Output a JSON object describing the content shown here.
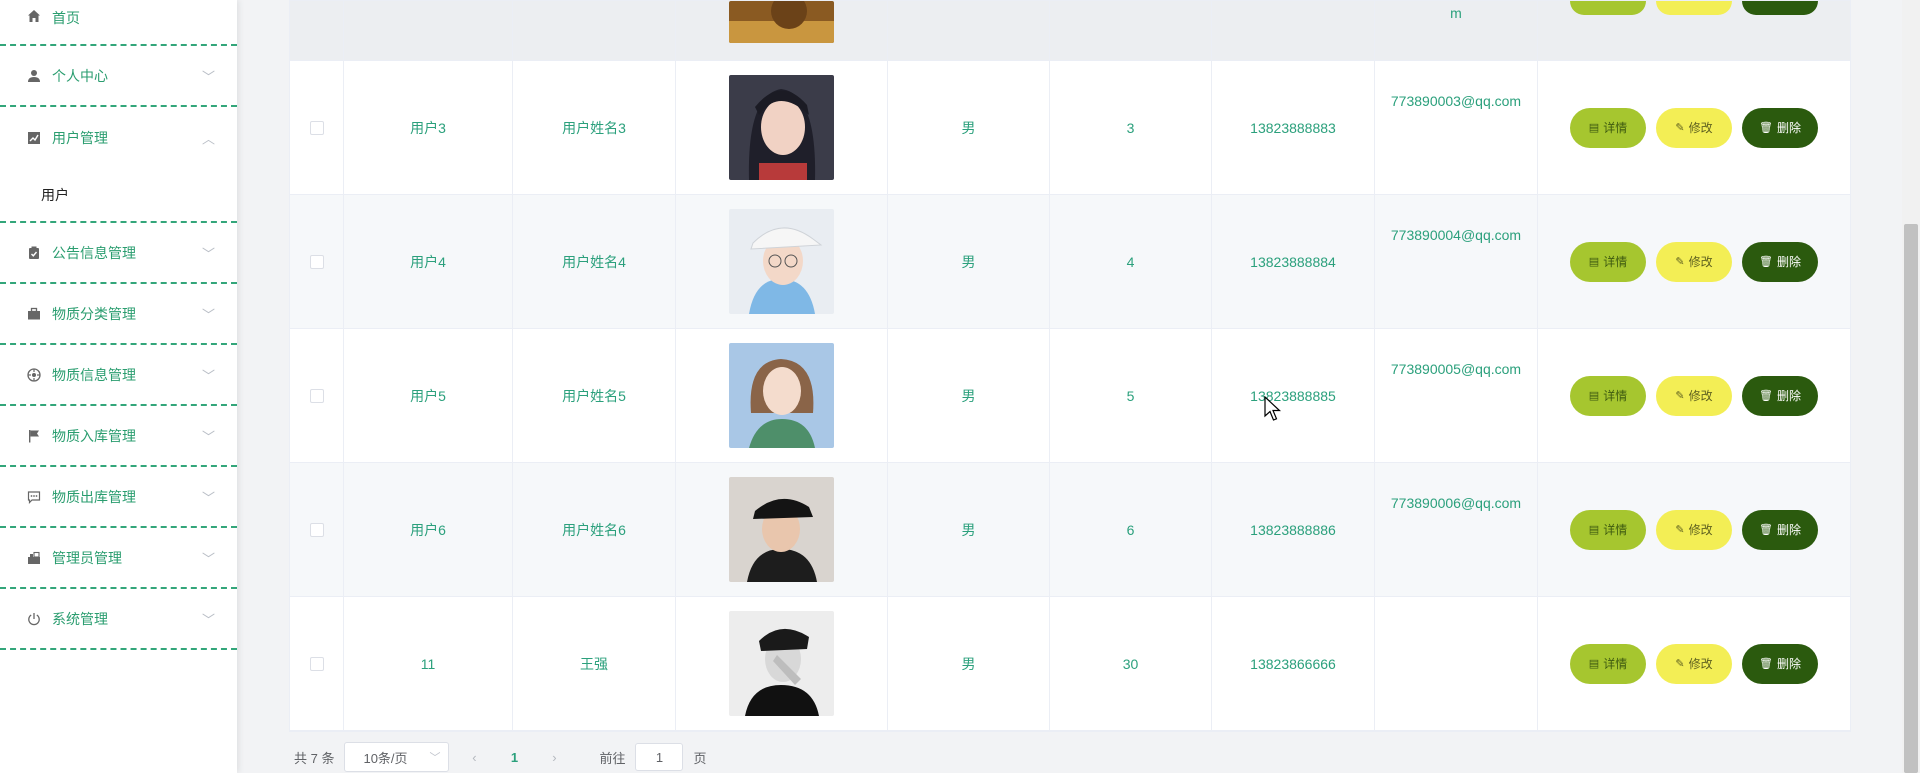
{
  "sidebar": {
    "items": [
      {
        "label": "首页",
        "icon": "home-icon"
      },
      {
        "label": "个人中心",
        "icon": "user-icon"
      },
      {
        "label": "用户管理",
        "icon": "chart-icon",
        "expanded": true,
        "children": [
          {
            "label": "用户"
          }
        ]
      },
      {
        "label": "公告信息管理",
        "icon": "clipboard-icon"
      },
      {
        "label": "物质分类管理",
        "icon": "briefcase-icon"
      },
      {
        "label": "物质信息管理",
        "icon": "compass-icon"
      },
      {
        "label": "物质入库管理",
        "icon": "flag-icon"
      },
      {
        "label": "物质出库管理",
        "icon": "chat-icon"
      },
      {
        "label": "管理员管理",
        "icon": "stack-icon"
      },
      {
        "label": "系统管理",
        "icon": "power-icon"
      }
    ]
  },
  "table": {
    "partial_row": {
      "email_tail": "m"
    },
    "rows": [
      {
        "account": "用户3",
        "name": "用户姓名3",
        "sex": "男",
        "age": "3",
        "phone": "13823888883",
        "email": "773890003@qq.com"
      },
      {
        "account": "用户4",
        "name": "用户姓名4",
        "sex": "男",
        "age": "4",
        "phone": "13823888884",
        "email": "773890004@qq.com"
      },
      {
        "account": "用户5",
        "name": "用户姓名5",
        "sex": "男",
        "age": "5",
        "phone": "13823888885",
        "email": "773890005@qq.com"
      },
      {
        "account": "用户6",
        "name": "用户姓名6",
        "sex": "男",
        "age": "6",
        "phone": "13823888886",
        "email": "773890006@qq.com"
      },
      {
        "account": "11",
        "name": "王强",
        "sex": "男",
        "age": "30",
        "phone": "13823866666",
        "email": ""
      }
    ],
    "buttons": {
      "detail": "详情",
      "edit": "修改",
      "delete": "删除"
    }
  },
  "pagination": {
    "total": "共 7 条",
    "page_size": "10条/页",
    "current_page": "1",
    "goto_label": "前往",
    "goto_value": "1",
    "page_suffix": "页"
  },
  "colors": {
    "accent": "#2ba07c",
    "detail_btn": "#a6c62f",
    "edit_btn": "#f3ee55",
    "delete_btn": "#2b5a0e"
  }
}
